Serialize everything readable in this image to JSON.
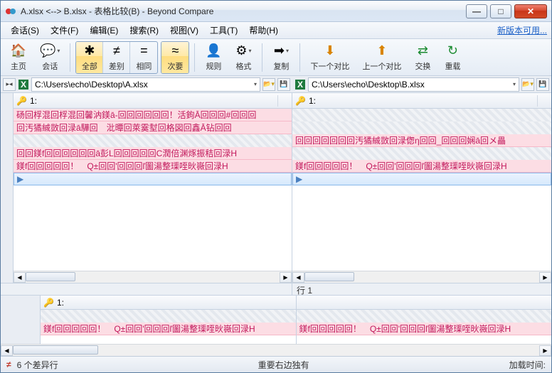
{
  "window": {
    "title": "A.xlsx <--> B.xlsx - 表格比较(B) - Beyond Compare"
  },
  "menu": {
    "session": "会话(S)",
    "file": "文件(F)",
    "edit": "编辑(E)",
    "search": "搜索(R)",
    "view": "视图(V)",
    "tools": "工具(T)",
    "help": "帮助(H)",
    "update": "新版本可用..."
  },
  "toolbar": {
    "home": "主页",
    "session": "会话",
    "all": "全部",
    "diff": "差别",
    "same": "相同",
    "minor": "次要",
    "rules": "规则",
    "format": "格式",
    "copy": "复制",
    "next": "下一个对比",
    "prev": "上一个对比",
    "swap": "交换",
    "reload": "重载",
    "sym_all": "✱",
    "sym_diff": "≠",
    "sym_same": "=",
    "sym_minor": "≈"
  },
  "paths": {
    "left": "C:\\Users\\echo\\Desktop\\A.xlsx",
    "right": "C:\\Users\\echo\\Desktop\\B.xlsx"
  },
  "cols": {
    "key_label": "1:",
    "key_icon": "🔑"
  },
  "left_rows": [
    {
      "t": "diff",
      "text": "砀回桴混回桴混回馨汭鎂ā-回回回回回回！活鉤Ā回回回#回回回"
    },
    {
      "t": "diff",
      "text": "回汚獝絾敳回渌ā驊回　沘曋回萊霙堼回格図回鑫Ā钻回回"
    },
    {
      "t": "gap",
      "text": ""
    },
    {
      "t": "diff",
      "text": "回回鎂f回回回回回回ā彭L回回回回回C潤倍渊烼振秸回渌H"
    },
    {
      "t": "diff",
      "text": "鎂f回回回回回！　Q±回回'回回回ľ圗湯整璖咥炚嶶回渌H"
    },
    {
      "t": "sel",
      "text": ""
    }
  ],
  "right_rows": [
    {
      "t": "gap",
      "text": ""
    },
    {
      "t": "gap",
      "text": ""
    },
    {
      "t": "diff",
      "text": "回回回回回回回汚獝絾敳回渌偬η回回_回回回娴ā回メ畾"
    },
    {
      "t": "gap",
      "text": ""
    },
    {
      "t": "diff",
      "text": "鎂f回回回回回！　Q±回回'回回回ľ圗湯整璖咥炚嶶回渌H"
    },
    {
      "t": "sel",
      "text": ""
    }
  ],
  "bottom_left_rows": [
    {
      "t": "gap",
      "text": ""
    },
    {
      "t": "diff",
      "text": "鎂f回回回回回！　Q±回回'回回回ľ圗湯整璖咥炚嶶回渌H"
    }
  ],
  "bottom_right_rows": [
    {
      "t": "gap",
      "text": ""
    },
    {
      "t": "diff",
      "text": "鎂f回回回回回！　Q±回回'回回回ľ圗湯整璖咥炚嶶回渌H"
    }
  ],
  "footer": {
    "right_line": "行 1"
  },
  "status": {
    "diff_count": "6 个差异行",
    "important": "重要右边独有",
    "load_time": "加载时间:"
  }
}
